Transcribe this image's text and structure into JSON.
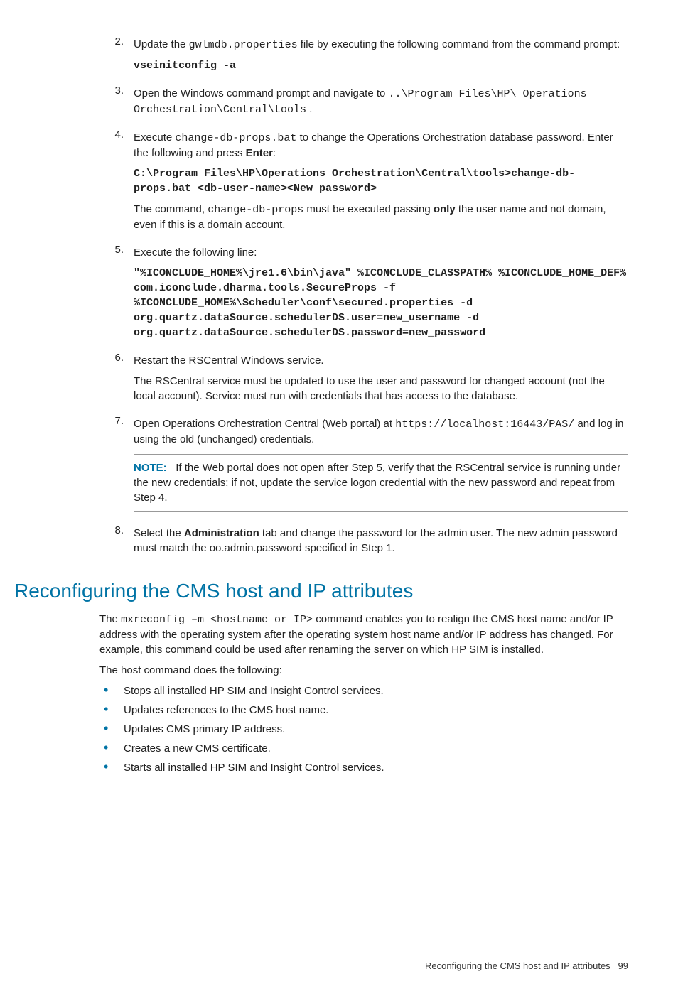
{
  "steps": {
    "s2": {
      "num": "2.",
      "t1": "Update the ",
      "code1": "gwlmdb.properties",
      "t2": " file by executing the following command from the command prompt:",
      "cmd": "vseinitconfig -a"
    },
    "s3": {
      "num": "3.",
      "t1": "Open the Windows command prompt and navigate to ",
      "code1": "..\\Program Files\\HP\\ Operations Orchestration\\Central\\tools",
      "t2": " ."
    },
    "s4": {
      "num": "4.",
      "t1": "Execute ",
      "code1": "change-db-props.bat",
      "t2": " to change the Operations Orchestration database password. Enter the following and press ",
      "bold1": "Enter",
      "t3": ":",
      "cmd": "C:\\Program Files\\HP\\Operations Orchestration\\Central\\tools>change-db-props.bat <db-user-name><New password>",
      "p2a": "The command, ",
      "p2code": "change-db-props",
      "p2b": " must be executed passing ",
      "p2bold": "only",
      "p2c": " the user name and not domain, even if this is a domain account."
    },
    "s5": {
      "num": "5.",
      "t1": "Execute the following line:",
      "cmd": "\"%ICONCLUDE_HOME%\\jre1.6\\bin\\java\" %ICONCLUDE_CLASSPATH% %ICONCLUDE_HOME_DEF% com.iconclude.dharma.tools.SecureProps -f %ICONCLUDE_HOME%\\Scheduler\\conf\\secured.properties -d org.quartz.dataSource.schedulerDS.user=new_username -d org.quartz.dataSource.schedulerDS.password=new_password"
    },
    "s6": {
      "num": "6.",
      "t1": "Restart the RSCentral Windows service.",
      "p2": "The RSCentral service must be updated to use the user and password for changed account (not the local account). Service must run with credentials that has access to the database."
    },
    "s7": {
      "num": "7.",
      "t1": "Open Operations Orchestration Central (Web portal) at ",
      "code1": "https://localhost:16443/PAS/",
      "t2": " and log in using the old (unchanged) credentials.",
      "note_label": "NOTE:",
      "note_body": "If the Web portal does not open after Step 5, verify that the RSCentral service is running under the new credentials; if not, update the service logon credential with the new password and repeat from Step 4."
    },
    "s8": {
      "num": "8.",
      "t1": "Select the ",
      "bold1": "Administration",
      "t2": " tab and change the password for the admin user. The new admin password must match the oo.admin.password specified in Step 1."
    }
  },
  "section": {
    "title": "Reconfiguring the CMS host and IP attributes",
    "p1a": "The ",
    "p1code": "mxreconfig –m <hostname or IP>",
    "p1b": " command enables you to realign the CMS host name and/or IP address with the operating system after the operating system host name and/or IP address has changed. For example, this command could be used after renaming the server on which HP SIM is installed.",
    "p2": "The host command does the following:",
    "bullets": [
      "Stops all installed HP SIM and Insight Control services.",
      "Updates references to the CMS host name.",
      "Updates CMS primary IP address.",
      "Creates a new CMS certificate.",
      "Starts all installed HP SIM and Insight Control services."
    ]
  },
  "footer": {
    "title": "Reconfiguring the CMS host and IP attributes",
    "page": "99"
  }
}
